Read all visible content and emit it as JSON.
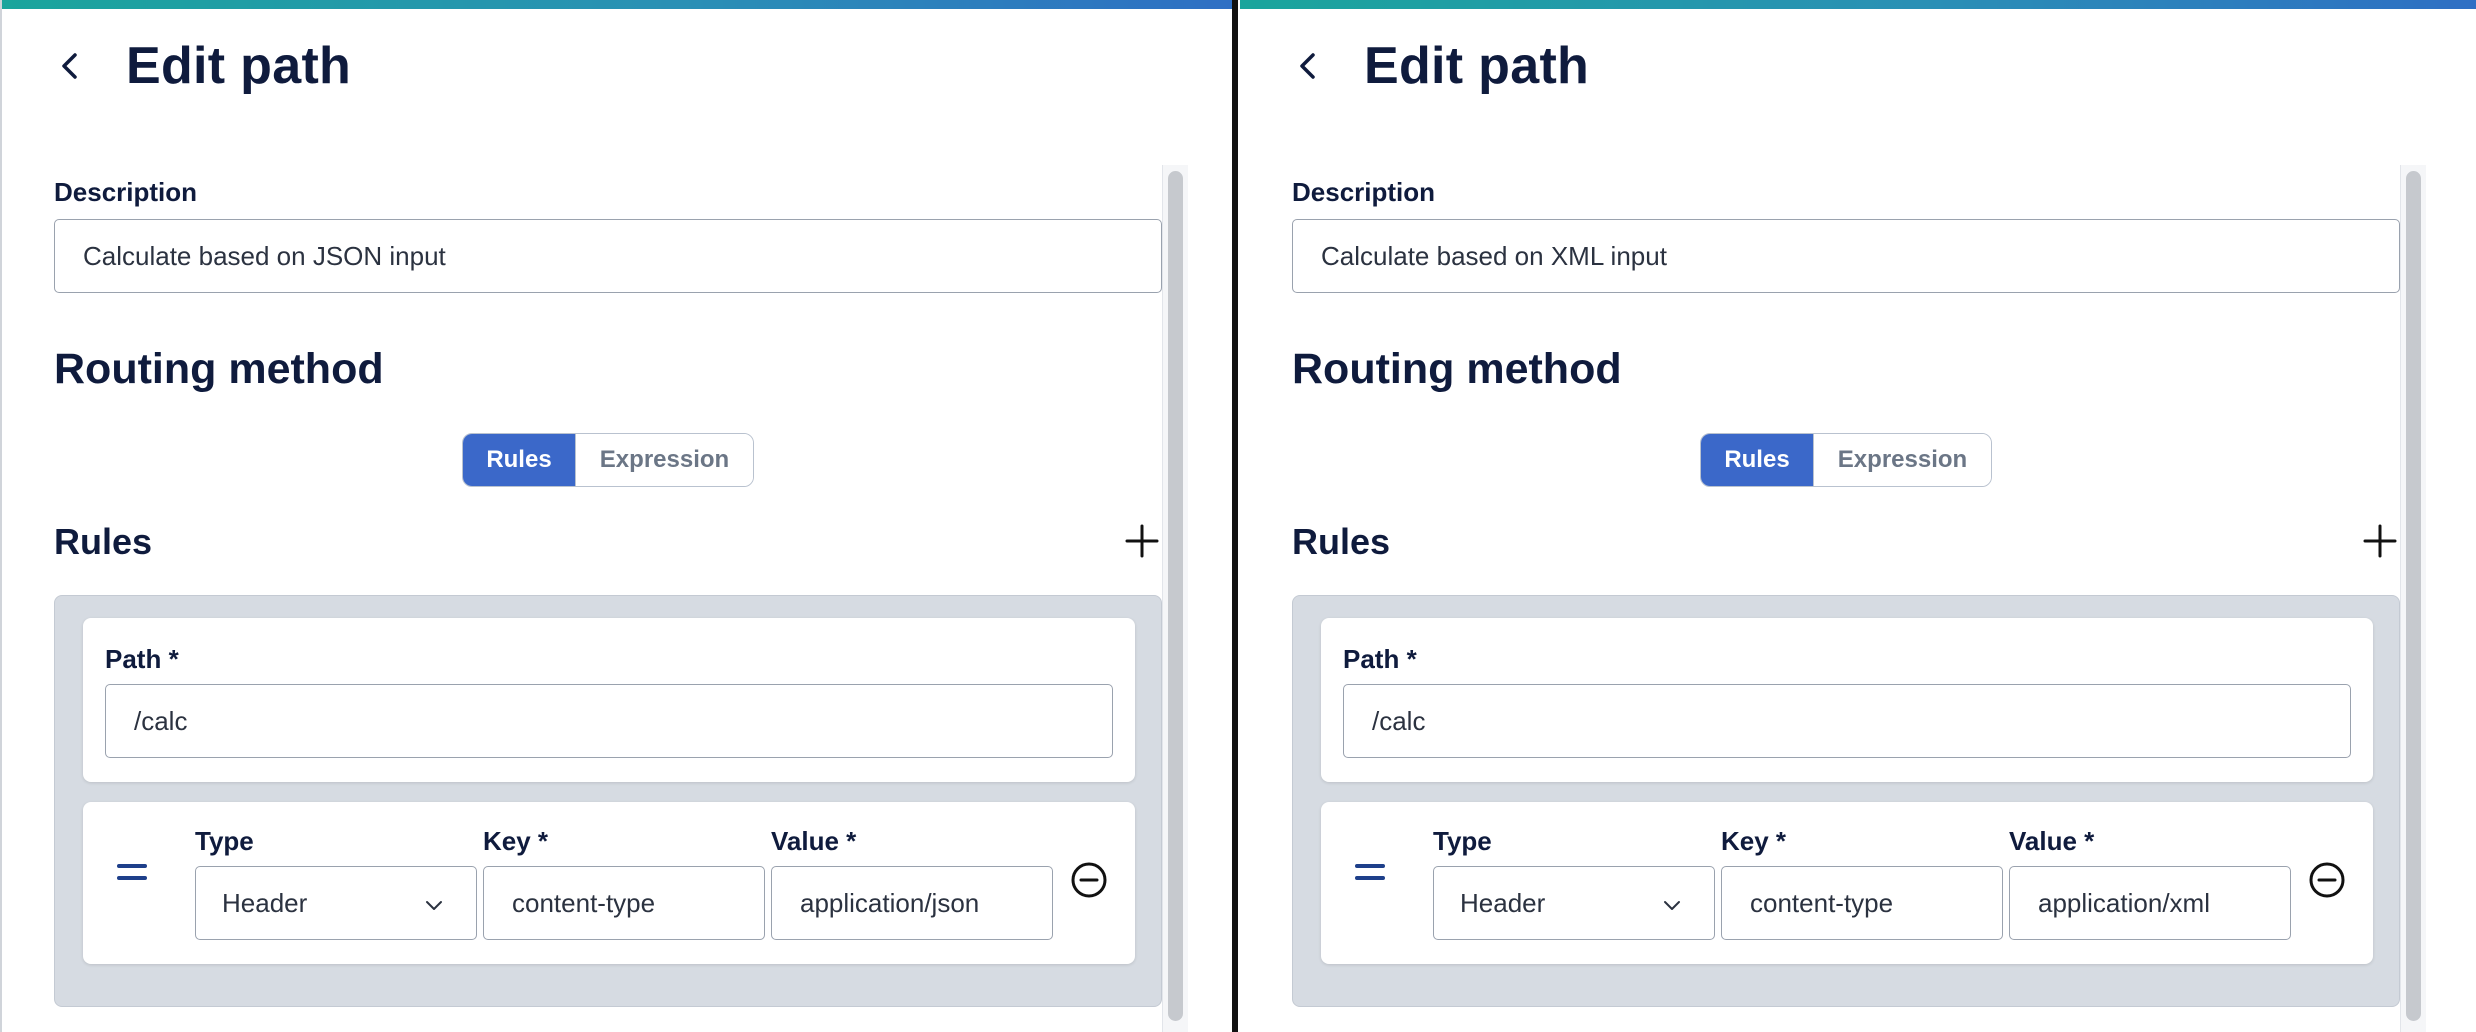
{
  "panels": [
    {
      "title": "Edit path",
      "description_label": "Description",
      "description_value": "Calculate based on JSON input",
      "routing_title": "Routing method",
      "toggle": {
        "active": "Rules",
        "inactive": "Expression"
      },
      "rules_title": "Rules",
      "path_label": "Path *",
      "path_value": "/calc",
      "rule": {
        "type_label": "Type",
        "type_value": "Header",
        "key_label": "Key *",
        "key_value": "content-type",
        "value_label": "Value *",
        "value_value": "application/json"
      }
    },
    {
      "title": "Edit path",
      "description_label": "Description",
      "description_value": "Calculate based on XML input",
      "routing_title": "Routing method",
      "toggle": {
        "active": "Rules",
        "inactive": "Expression"
      },
      "rules_title": "Rules",
      "path_label": "Path *",
      "path_value": "/calc",
      "rule": {
        "type_label": "Type",
        "type_value": "Header",
        "key_label": "Key *",
        "key_value": "content-type",
        "value_label": "Value *",
        "value_value": "application/xml"
      }
    }
  ],
  "icons": {
    "back": "chevron-left-icon",
    "add": "plus-icon",
    "remove": "minus-circle-icon",
    "dropdown": "chevron-down-icon",
    "drag": "equals-icon"
  },
  "colors": {
    "accent": "#3b68c9",
    "heading": "#0f1b3d",
    "rules_bg": "#d6dbe2",
    "topbar_start": "#1aa59c",
    "topbar_end": "#2f6fc4"
  }
}
